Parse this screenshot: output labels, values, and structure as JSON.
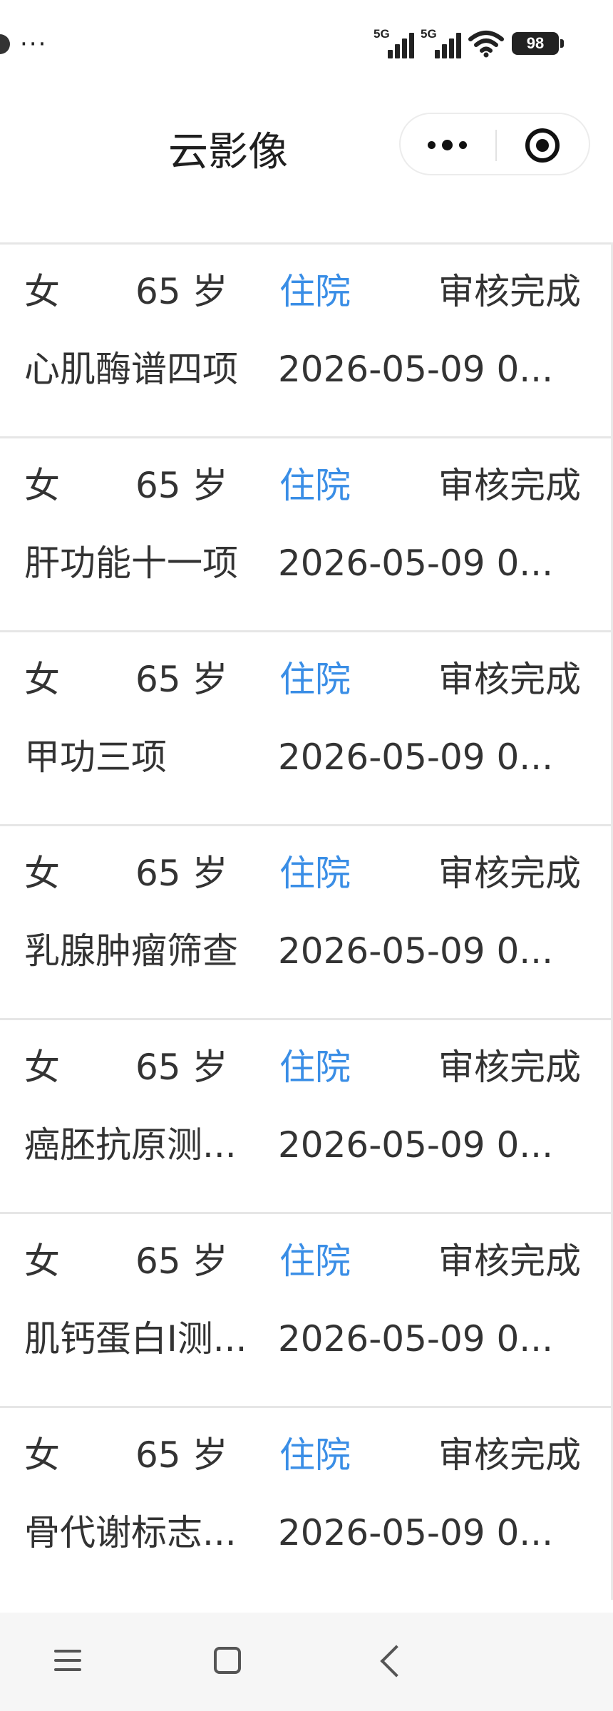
{
  "statusbar": {
    "more": "···",
    "sim1": "5G",
    "sim2": "5G",
    "battery": "98"
  },
  "header": {
    "title": "云影像"
  },
  "records": [
    {
      "sex": "女",
      "age": "65 岁",
      "dept": "住院",
      "status": "审核完成",
      "item": "心肌酶谱四项",
      "date": "2026-05-09 0..."
    },
    {
      "sex": "女",
      "age": "65 岁",
      "dept": "住院",
      "status": "审核完成",
      "item": "肝功能十一项",
      "date": "2026-05-09 0..."
    },
    {
      "sex": "女",
      "age": "65 岁",
      "dept": "住院",
      "status": "审核完成",
      "item": "甲功三项",
      "date": "2026-05-09 0..."
    },
    {
      "sex": "女",
      "age": "65 岁",
      "dept": "住院",
      "status": "审核完成",
      "item": "乳腺肿瘤筛查",
      "date": "2026-05-09 0..."
    },
    {
      "sex": "女",
      "age": "65 岁",
      "dept": "住院",
      "status": "审核完成",
      "item": "癌胚抗原测...",
      "date": "2026-05-09 0..."
    },
    {
      "sex": "女",
      "age": "65 岁",
      "dept": "住院",
      "status": "审核完成",
      "item": "肌钙蛋白I测...",
      "date": "2026-05-09 0..."
    },
    {
      "sex": "女",
      "age": "65 岁",
      "dept": "住院",
      "status": "审核完成",
      "item": "骨代谢标志...",
      "date": "2026-05-09 0..."
    }
  ],
  "colors": {
    "accent": "#3a8ee6",
    "text": "#333333",
    "divider": "#e6e6e6"
  }
}
